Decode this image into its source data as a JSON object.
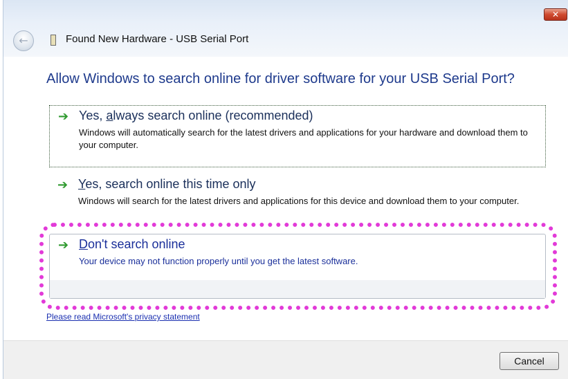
{
  "window": {
    "title": "Found New Hardware - USB Serial Port",
    "close_label": "✕"
  },
  "icons": {
    "back": "back-arrow-icon",
    "device": "usb-device-icon",
    "option_arrow": "green-arrow-icon"
  },
  "heading": "Allow Windows to search online for driver software for your USB Serial Port?",
  "options": [
    {
      "title_pre": "Yes, ",
      "title_ul": "a",
      "title_post": "lways search online (recommended)",
      "description": "Windows will automatically search for the latest drivers and applications for your hardware and download them to your computer."
    },
    {
      "title_pre": "",
      "title_ul": "Y",
      "title_post": "es, search online this time only",
      "description": "Windows will search for the latest drivers and applications for this device and download them to your computer."
    },
    {
      "title_pre": "",
      "title_ul": "D",
      "title_post": "on't search online",
      "description": "Your device may not function properly until you get the latest software."
    }
  ],
  "privacy_link": "Please read Microsoft's privacy statement",
  "footer": {
    "cancel_label": "Cancel"
  },
  "colors": {
    "heading": "#1e3a8c",
    "highlight": "#e23ad8",
    "arrow": "#2f9a2f",
    "link": "#1a2fb0"
  }
}
